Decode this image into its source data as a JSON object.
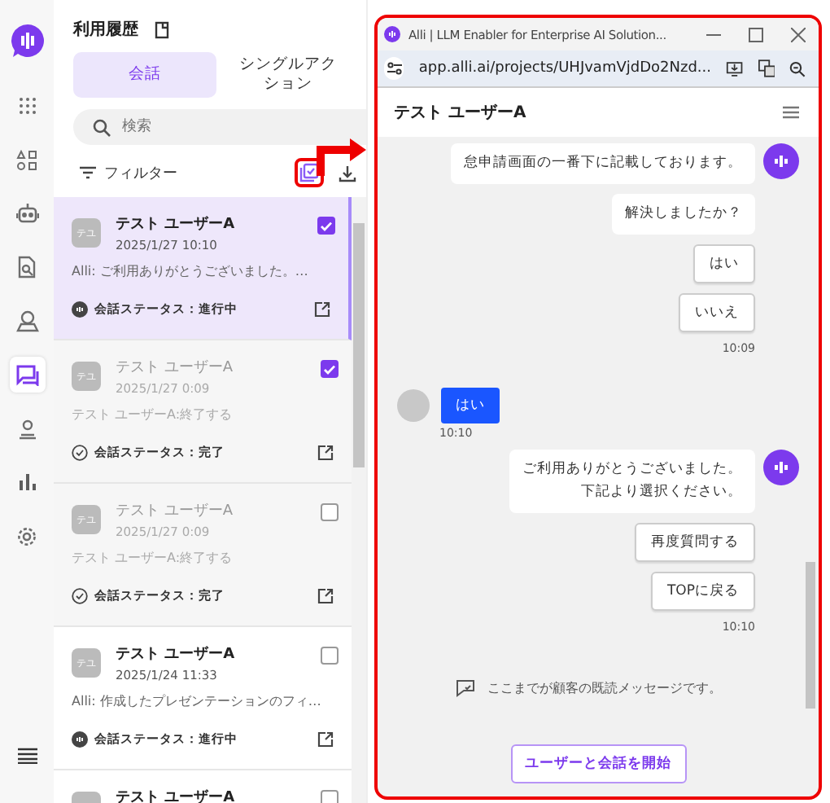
{
  "nav_icons": [
    {
      "kind": "grid",
      "selected": false
    },
    {
      "kind": "shapes",
      "selected": false
    },
    {
      "kind": "robot",
      "selected": false
    },
    {
      "kind": "doc-search",
      "selected": false
    },
    {
      "kind": "pin",
      "selected": false
    },
    {
      "kind": "chat",
      "selected": true
    },
    {
      "kind": "person",
      "selected": false
    },
    {
      "kind": "chart",
      "selected": false
    },
    {
      "kind": "gear",
      "selected": false
    }
  ],
  "panel": {
    "title": "利用履歴",
    "tabs": [
      {
        "label": "会話",
        "selected": true
      },
      {
        "label": "シングルアクション",
        "selected": false
      }
    ],
    "search": {
      "placeholder": "検索"
    },
    "filter": "フィルター"
  },
  "conversations": [
    {
      "avatar": "テユ",
      "name": "テスト ユーザーA",
      "date": "2025/1/27 10:10",
      "preview": "Alli: ご利用ありがとうございました。…",
      "status": "会話ステータス：進行中",
      "kind": "active",
      "selected": true,
      "checked": true,
      "faded": false
    },
    {
      "avatar": "テユ",
      "name": "テスト ユーザーA",
      "date": "2025/1/27 0:09",
      "preview": "テスト ユーザーA:終了する",
      "status": "会話ステータス：完了",
      "kind": "done",
      "selected": false,
      "checked": true,
      "faded": true
    },
    {
      "avatar": "テユ",
      "name": "テスト ユーザーA",
      "date": "2025/1/27 0:09",
      "preview": "テスト ユーザーA:終了する",
      "status": "会話ステータス：完了",
      "kind": "done",
      "selected": false,
      "checked": false,
      "faded": true
    },
    {
      "avatar": "テユ",
      "name": "テスト ユーザーA",
      "date": "2025/1/24 11:33",
      "preview": "Alli: 作成したプレゼンテーションのフィ…",
      "status": "会話ステータス：進行中",
      "kind": "active",
      "selected": false,
      "checked": false,
      "faded": false
    },
    {
      "name": "テスト ユーザーA",
      "selected": false,
      "checked": false,
      "faded": false
    }
  ],
  "popup": {
    "title": "Alli | LLM Enabler for Enterprise AI Solution...",
    "url": "app.alli.ai/projects/UHJvamVjdDo2Nzd...",
    "header": "テスト ユーザーA",
    "messages": [
      {
        "kind": "bot",
        "lines": [
          "怠申請画面の一番下に記載しております。"
        ],
        "avatar": true
      },
      {
        "kind": "bot",
        "lines": [
          "解決しましたか？"
        ],
        "avatar": false
      },
      {
        "kind": "choice",
        "text": "はい"
      },
      {
        "kind": "choice",
        "text": "いいえ"
      },
      {
        "kind": "bot-time",
        "text": "10:09"
      },
      {
        "kind": "user",
        "text": "はい"
      },
      {
        "kind": "user-time",
        "text": "10:10"
      },
      {
        "kind": "bot",
        "lines": [
          "ご利用ありがとうございました。",
          "下記より選択ください。"
        ],
        "avatar": true
      },
      {
        "kind": "choice",
        "text": "再度質問する"
      },
      {
        "kind": "choice",
        "text": "TOPに戻る"
      },
      {
        "kind": "bot-time",
        "text": "10:10"
      },
      {
        "kind": "read",
        "text": "ここまでが顧客の既読メッセージです。"
      }
    ],
    "start_button": "ユーザーと会話を開始"
  }
}
